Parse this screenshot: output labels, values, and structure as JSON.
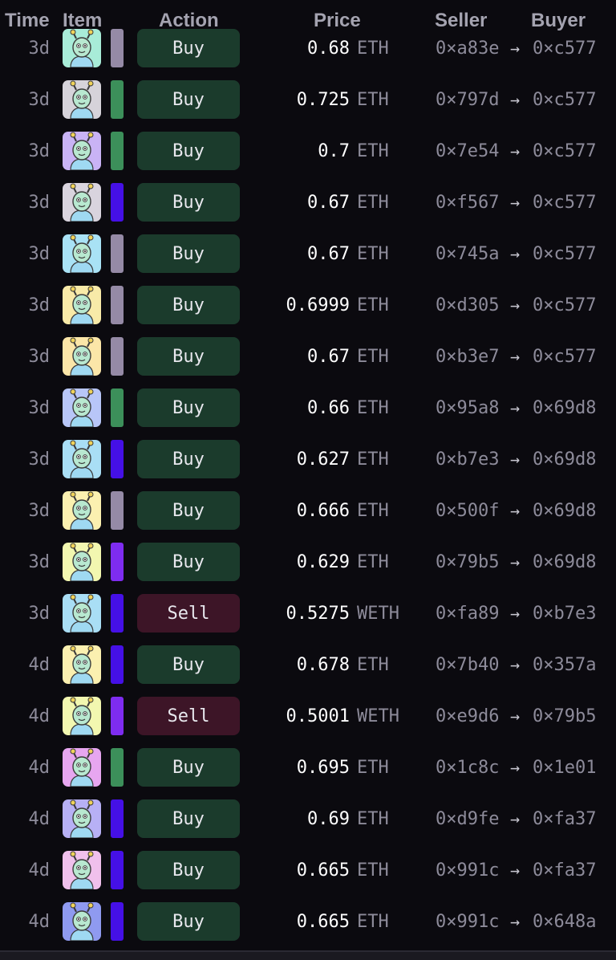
{
  "headers": {
    "time": "Time",
    "item": "Item",
    "action": "Action",
    "price": "Price",
    "seller": "Seller",
    "buyer": "Buyer"
  },
  "colors": {
    "buy_bg": "#1b3b2c",
    "sell_bg": "#3d1527",
    "rarity_gray": "#958aa6",
    "rarity_green": "#3c8f5a",
    "rarity_blue": "#4510e6",
    "rarity_purple": "#7e2cf0"
  },
  "arrow_glyph": "→",
  "sales": [
    {
      "time": "3d",
      "rarity": "rarity_gray",
      "action": "Buy",
      "price": "0.68",
      "currency": "ETH",
      "seller": "0×a83e",
      "buyer": "0×c577",
      "thumb_bg": "#a8ecd8",
      "icon": "nft-avatar-icon"
    },
    {
      "time": "3d",
      "rarity": "rarity_green",
      "action": "Buy",
      "price": "0.725",
      "currency": "ETH",
      "seller": "0×797d",
      "buyer": "0×c577",
      "thumb_bg": "#d6d3da",
      "icon": "nft-avatar-icon"
    },
    {
      "time": "3d",
      "rarity": "rarity_green",
      "action": "Buy",
      "price": "0.7",
      "currency": "ETH",
      "seller": "0×7e54",
      "buyer": "0×c577",
      "thumb_bg": "#c9b3f5",
      "icon": "nft-avatar-icon"
    },
    {
      "time": "3d",
      "rarity": "rarity_blue",
      "action": "Buy",
      "price": "0.67",
      "currency": "ETH",
      "seller": "0×f567",
      "buyer": "0×c577",
      "thumb_bg": "#d9d4de",
      "icon": "nft-avatar-icon"
    },
    {
      "time": "3d",
      "rarity": "rarity_gray",
      "action": "Buy",
      "price": "0.67",
      "currency": "ETH",
      "seller": "0×745a",
      "buyer": "0×c577",
      "thumb_bg": "#a9e2f5",
      "icon": "nft-avatar-icon"
    },
    {
      "time": "3d",
      "rarity": "rarity_gray",
      "action": "Buy",
      "price": "0.6999",
      "currency": "ETH",
      "seller": "0×d305",
      "buyer": "0×c577",
      "thumb_bg": "#f8eaa8",
      "icon": "nft-avatar-icon"
    },
    {
      "time": "3d",
      "rarity": "rarity_gray",
      "action": "Buy",
      "price": "0.67",
      "currency": "ETH",
      "seller": "0×b3e7",
      "buyer": "0×c577",
      "thumb_bg": "#fbe6a8",
      "icon": "nft-avatar-icon"
    },
    {
      "time": "3d",
      "rarity": "rarity_green",
      "action": "Buy",
      "price": "0.66",
      "currency": "ETH",
      "seller": "0×95a8",
      "buyer": "0×69d8",
      "thumb_bg": "#b8c6f8",
      "icon": "nft-avatar-icon"
    },
    {
      "time": "3d",
      "rarity": "rarity_blue",
      "action": "Buy",
      "price": "0.627",
      "currency": "ETH",
      "seller": "0×b7e3",
      "buyer": "0×69d8",
      "thumb_bg": "#a9def5",
      "icon": "nft-avatar-icon"
    },
    {
      "time": "3d",
      "rarity": "rarity_gray",
      "action": "Buy",
      "price": "0.666",
      "currency": "ETH",
      "seller": "0×500f",
      "buyer": "0×69d8",
      "thumb_bg": "#fbf0b0",
      "icon": "nft-avatar-icon"
    },
    {
      "time": "3d",
      "rarity": "rarity_purple",
      "action": "Buy",
      "price": "0.629",
      "currency": "ETH",
      "seller": "0×79b5",
      "buyer": "0×69d8",
      "thumb_bg": "#f2f7b0",
      "icon": "nft-avatar-icon"
    },
    {
      "time": "3d",
      "rarity": "rarity_blue",
      "action": "Sell",
      "price": "0.5275",
      "currency": "WETH",
      "seller": "0×fa89",
      "buyer": "0×b7e3",
      "thumb_bg": "#a9def5",
      "icon": "nft-avatar-icon"
    },
    {
      "time": "4d",
      "rarity": "rarity_blue",
      "action": "Buy",
      "price": "0.678",
      "currency": "ETH",
      "seller": "0×7b40",
      "buyer": "0×357a",
      "thumb_bg": "#fbf0b0",
      "icon": "nft-avatar-icon"
    },
    {
      "time": "4d",
      "rarity": "rarity_purple",
      "action": "Sell",
      "price": "0.5001",
      "currency": "WETH",
      "seller": "0×e9d6",
      "buyer": "0×79b5",
      "thumb_bg": "#f2f7b0",
      "icon": "nft-avatar-icon"
    },
    {
      "time": "4d",
      "rarity": "rarity_green",
      "action": "Buy",
      "price": "0.695",
      "currency": "ETH",
      "seller": "0×1c8c",
      "buyer": "0×1e01",
      "thumb_bg": "#e7a6f0",
      "icon": "nft-avatar-icon"
    },
    {
      "time": "4d",
      "rarity": "rarity_blue",
      "action": "Buy",
      "price": "0.69",
      "currency": "ETH",
      "seller": "0×d9fe",
      "buyer": "0×fa37",
      "thumb_bg": "#b7b0f5",
      "icon": "nft-avatar-icon"
    },
    {
      "time": "4d",
      "rarity": "rarity_blue",
      "action": "Buy",
      "price": "0.665",
      "currency": "ETH",
      "seller": "0×991c",
      "buyer": "0×fa37",
      "thumb_bg": "#f0c0ec",
      "icon": "nft-avatar-icon"
    },
    {
      "time": "4d",
      "rarity": "rarity_blue",
      "action": "Buy",
      "price": "0.665",
      "currency": "ETH",
      "seller": "0×991c",
      "buyer": "0×648a",
      "thumb_bg": "#8f9af0",
      "icon": "nft-avatar-icon"
    }
  ]
}
